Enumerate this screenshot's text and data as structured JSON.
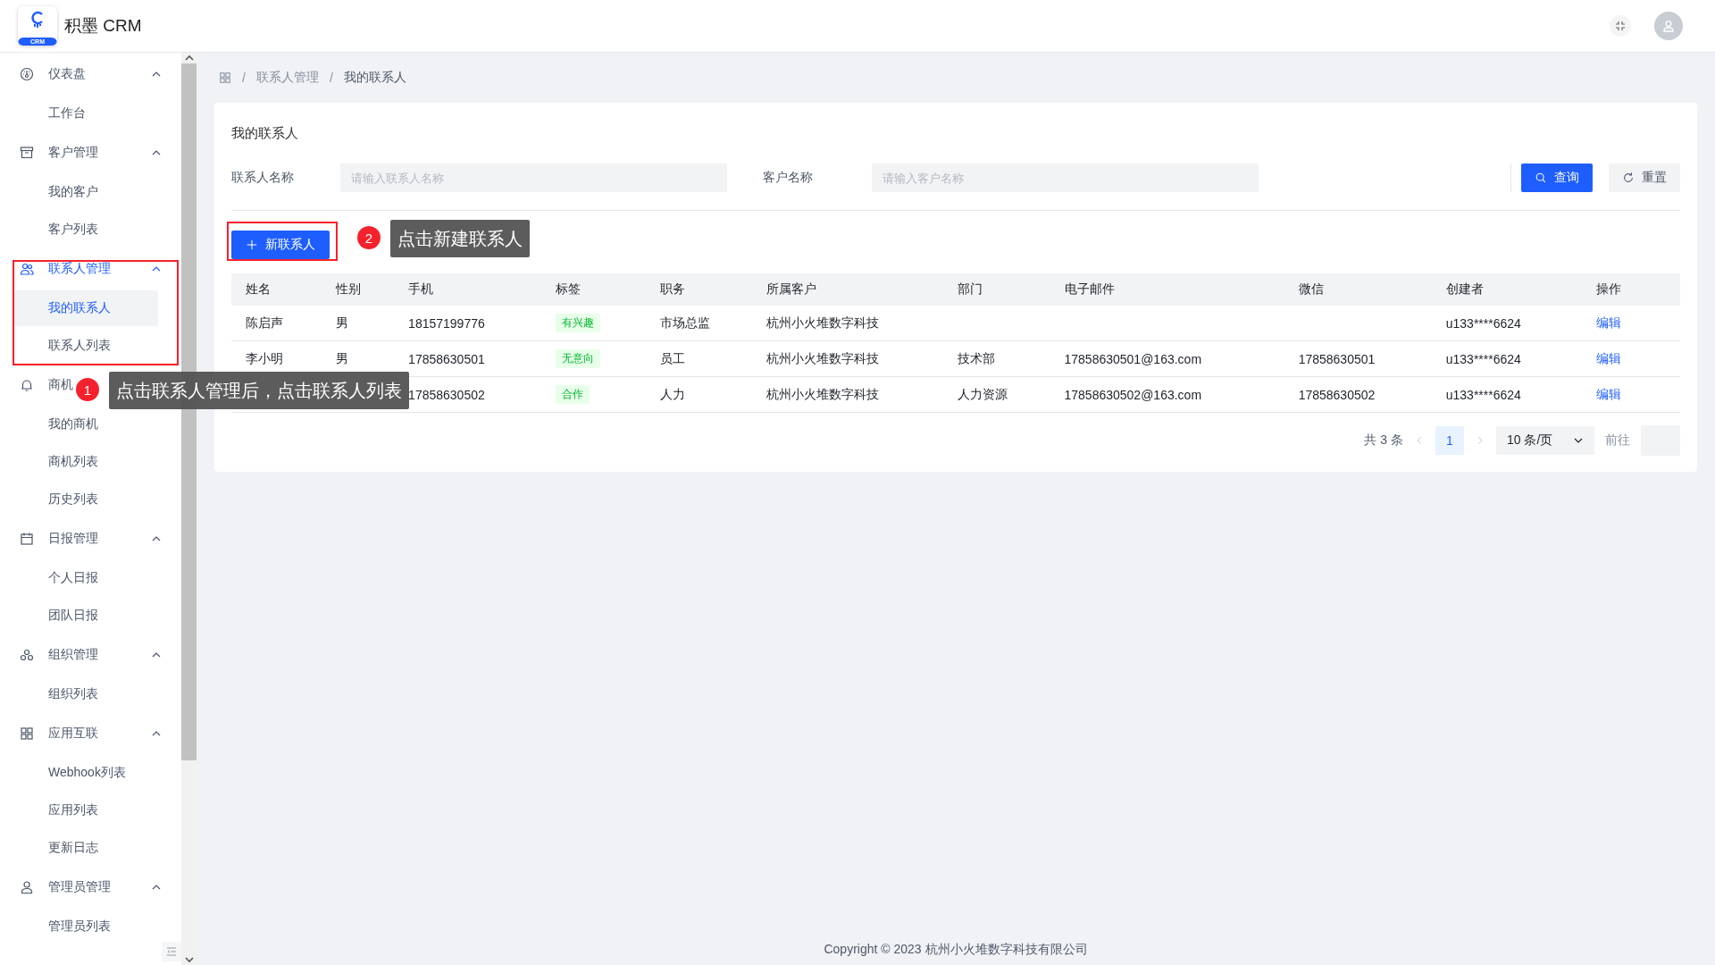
{
  "header": {
    "logo_text": "CRM",
    "title": "积墨 CRM"
  },
  "sidebar": {
    "groups": [
      {
        "label": "仪表盘",
        "expanded": true,
        "selected": false,
        "children": [
          {
            "label": "工作台",
            "selected": false
          }
        ]
      },
      {
        "label": "客户管理",
        "expanded": true,
        "selected": false,
        "children": [
          {
            "label": "我的客户",
            "selected": false
          },
          {
            "label": "客户列表",
            "selected": false
          }
        ]
      },
      {
        "label": "联系人管理",
        "expanded": true,
        "selected": true,
        "children": [
          {
            "label": "我的联系人",
            "selected": true
          },
          {
            "label": "联系人列表",
            "selected": false
          }
        ]
      },
      {
        "label": "商机",
        "expanded": true,
        "selected": false,
        "children": [
          {
            "label": "我的商机",
            "selected": false
          },
          {
            "label": "商机列表",
            "selected": false
          },
          {
            "label": "历史列表",
            "selected": false
          }
        ]
      },
      {
        "label": "日报管理",
        "expanded": true,
        "selected": false,
        "children": [
          {
            "label": "个人日报",
            "selected": false
          },
          {
            "label": "团队日报",
            "selected": false
          }
        ]
      },
      {
        "label": "组织管理",
        "expanded": true,
        "selected": false,
        "children": [
          {
            "label": "组织列表",
            "selected": false
          }
        ]
      },
      {
        "label": "应用互联",
        "expanded": true,
        "selected": false,
        "children": [
          {
            "label": "Webhook列表",
            "selected": false
          },
          {
            "label": "应用列表",
            "selected": false
          },
          {
            "label": "更新日志",
            "selected": false
          }
        ]
      },
      {
        "label": "管理员管理",
        "expanded": true,
        "selected": false,
        "children": [
          {
            "label": "管理员列表",
            "selected": false
          }
        ]
      }
    ]
  },
  "breadcrumb": [
    "联系人管理",
    "我的联系人"
  ],
  "breadcrumb_separator": "/",
  "card": {
    "title": "我的联系人",
    "filters": [
      {
        "label": "联系人名称",
        "placeholder": "请输入联系人名称"
      },
      {
        "label": "客户名称",
        "placeholder": "请输入客户名称"
      }
    ],
    "query_button": "查询",
    "reset_button": "重置",
    "new_button": "新联系人"
  },
  "table": {
    "columns": [
      "姓名",
      "性别",
      "手机",
      "标签",
      "职务",
      "所属客户",
      "部门",
      "电子邮件",
      "微信",
      "创建者",
      "操作"
    ],
    "rows": [
      {
        "name": "陈启声",
        "gender": "男",
        "phone": "18157199776",
        "tag": "有兴趣",
        "title": "市场总监",
        "customer": "杭州小火堆数字科技",
        "creator": "u133****6624",
        "action": "编辑"
      },
      {
        "name": "李小明",
        "gender": "男",
        "phone": "17858630501",
        "tag": "无意向",
        "title": "员工",
        "customer": "杭州小火堆数字科技",
        "department": "技术部",
        "email": "17858630501@163.com",
        "wechat": "17858630501",
        "creator": "u133****6624",
        "action": "编辑"
      },
      {
        "phone": "17858630502",
        "tag": "合作",
        "title": "人力",
        "customer": "杭州小火堆数字科技",
        "department": "人力资源",
        "email": "17858630502@163.com",
        "wechat": "17858630502",
        "creator": "u133****6624",
        "action": "编辑"
      }
    ]
  },
  "pagination": {
    "total": "共 3 条",
    "pages": [
      {
        "label": "1",
        "selected": true
      }
    ],
    "page_size": "10 条/页",
    "goto_label": "前往"
  },
  "footer": "Copyright © 2023 杭州小火堆数字科技有限公司",
  "annotations": [
    {
      "number": "1",
      "text": "点击联系人管理后，点击联系人列表"
    },
    {
      "number": "2",
      "text": "点击新建联系人"
    }
  ]
}
